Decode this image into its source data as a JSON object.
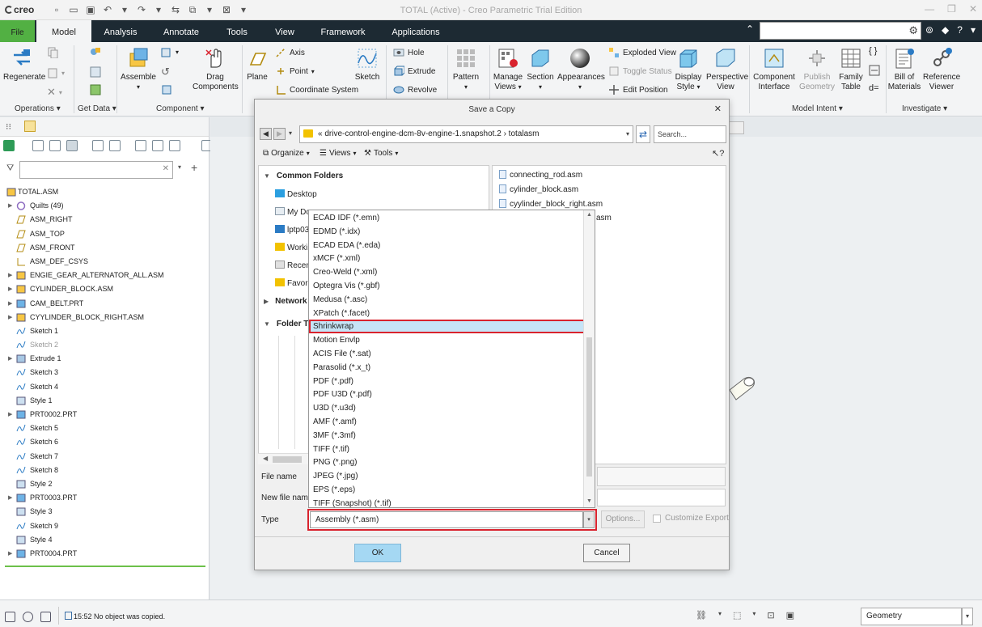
{
  "titlebar": {
    "title": "TOTAL (Active) - Creo Parametric Trial Edition",
    "logo": "creo"
  },
  "tabs": [
    {
      "label": "File"
    },
    {
      "label": "Model"
    },
    {
      "label": "Analysis"
    },
    {
      "label": "Annotate"
    },
    {
      "label": "Tools"
    },
    {
      "label": "View"
    },
    {
      "label": "Framework"
    },
    {
      "label": "Applications"
    }
  ],
  "ribbon": {
    "regenerate": "Regenerate",
    "assemble": "Assemble",
    "drag_components": [
      "Drag",
      "Components"
    ],
    "plane": "Plane",
    "axis": "Axis",
    "point": "Point",
    "coordinate_system": "Coordinate System",
    "sketch": "Sketch",
    "hole": "Hole",
    "extrude": "Extrude",
    "revolve": "Revolve",
    "pattern": "Pattern",
    "manage_views": [
      "Manage",
      "Views"
    ],
    "section": "Section",
    "appearances": "Appearances",
    "exploded_view": "Exploded View",
    "toggle_status": "Toggle Status",
    "edit_position": "Edit Position",
    "display_style": [
      "Display",
      "Style"
    ],
    "perspective_view": [
      "Perspective",
      "View"
    ],
    "component_interface": [
      "Component",
      "Interface"
    ],
    "publish_geometry": [
      "Publish",
      "Geometry"
    ],
    "family_table": [
      "Family",
      "Table"
    ],
    "bill_of_materials": [
      "Bill of",
      "Materials"
    ],
    "reference_viewer": [
      "Reference",
      "Viewer"
    ],
    "groups": {
      "operations": "Operations",
      "get_data": "Get Data",
      "component": "Component",
      "model_intent": "Model Intent",
      "investigate": "Investigate"
    }
  },
  "tree": [
    {
      "label": "TOTAL.ASM",
      "icon": "assembly-icon",
      "root": true
    },
    {
      "label": "Quilts (49)",
      "icon": "quilts-icon",
      "expand": true
    },
    {
      "label": "ASM_RIGHT",
      "icon": "datum-plane-icon"
    },
    {
      "label": "ASM_TOP",
      "icon": "datum-plane-icon"
    },
    {
      "label": "ASM_FRONT",
      "icon": "datum-plane-icon"
    },
    {
      "label": "ASM_DEF_CSYS",
      "icon": "csys-icon"
    },
    {
      "label": "ENGIE_GEAR_ALTERNATOR_ALL.ASM",
      "icon": "assembly-icon",
      "expand": true
    },
    {
      "label": "CYLINDER_BLOCK.ASM",
      "icon": "assembly-icon",
      "expand": true
    },
    {
      "label": "CAM_BELT.PRT",
      "icon": "part-icon",
      "expand": true
    },
    {
      "label": "CYYLINDER_BLOCK_RIGHT.ASM",
      "icon": "assembly-icon",
      "expand": true
    },
    {
      "label": "Sketch 1",
      "icon": "sketch-icon"
    },
    {
      "label": "Sketch 2",
      "icon": "sketch-icon",
      "dim": true
    },
    {
      "label": "Extrude 1",
      "icon": "extrude-icon",
      "expand": true
    },
    {
      "label": "Sketch 3",
      "icon": "sketch-icon"
    },
    {
      "label": "Sketch 4",
      "icon": "sketch-icon"
    },
    {
      "label": "Style 1",
      "icon": "style-icon"
    },
    {
      "label": "PRT0002.PRT",
      "icon": "part-icon",
      "expand": true
    },
    {
      "label": "Sketch 5",
      "icon": "sketch-icon"
    },
    {
      "label": "Sketch 6",
      "icon": "sketch-icon"
    },
    {
      "label": "Sketch 7",
      "icon": "sketch-icon"
    },
    {
      "label": "Sketch 8",
      "icon": "sketch-icon"
    },
    {
      "label": "Style 2",
      "icon": "style-icon"
    },
    {
      "label": "PRT0003.PRT",
      "icon": "part-icon",
      "expand": true
    },
    {
      "label": "Style 3",
      "icon": "style-icon"
    },
    {
      "label": "Sketch 9",
      "icon": "sketch-icon"
    },
    {
      "label": "Style 4",
      "icon": "style-icon"
    },
    {
      "label": "PRT0004.PRT",
      "icon": "part-icon",
      "expand": true
    }
  ],
  "dialog": {
    "title": "Save a Copy",
    "address": "«   drive-control-engine-dcm-8v-engine-1.snapshot.2  ›  totalasm",
    "search_placeholder": "Search...",
    "organize": "Organize",
    "views": "Views",
    "tools": "Tools",
    "help": "?",
    "nav": {
      "common_folders": "Common Folders",
      "desktop": "Desktop",
      "my_documents": "My Do",
      "lptp": "lptp03",
      "working": "Workin",
      "recent": "Recent",
      "favorites": "Favorit",
      "network": "Network",
      "folder_tree": "Folder Tr"
    },
    "files": [
      "connecting_rod.asm",
      "cylinder_block.asm",
      "cyylinder_block_right.asm",
      "asm"
    ],
    "file_name_label": "File name",
    "new_file_name_label": "New file name",
    "type_label": "Type",
    "type_value": "Assembly (*.asm)",
    "options": "Options...",
    "customize_export": "Customize Export",
    "ok": "OK",
    "cancel": "Cancel",
    "type_options": [
      "ECAD IDF (*.emn)",
      "EDMD (*.idx)",
      "ECAD EDA (*.eda)",
      "xMCF  (*.xml)",
      "Creo-Weld (*.xml)",
      "Optegra Vis (*.gbf)",
      "Medusa (*.asc)",
      "XPatch (*.facet)",
      "Shrinkwrap",
      "Motion Envlp",
      "ACIS File (*.sat)",
      "Parasolid (*.x_t)",
      "PDF (*.pdf)",
      "PDF U3D (*.pdf)",
      "U3D (*.u3d)",
      "AMF (*.amf)",
      "3MF (*.3mf)",
      "TIFF (*.tif)",
      "PNG (*.png)",
      "JPEG (*.jpg)",
      "EPS  (*.eps)",
      "TIFF (Snapshot) (*.tif)"
    ],
    "selected_option": "Shrinkwrap"
  },
  "statusbar": {
    "message": "15:52 No object was copied.",
    "filter_value": "Geometry"
  },
  "colors": {
    "file_tab": "#52b043",
    "tab_bar": "#1d2a33",
    "highlight_box": "#d9232e",
    "selected_item": "#c6e4f7",
    "ok_button": "#a5d8f3"
  }
}
